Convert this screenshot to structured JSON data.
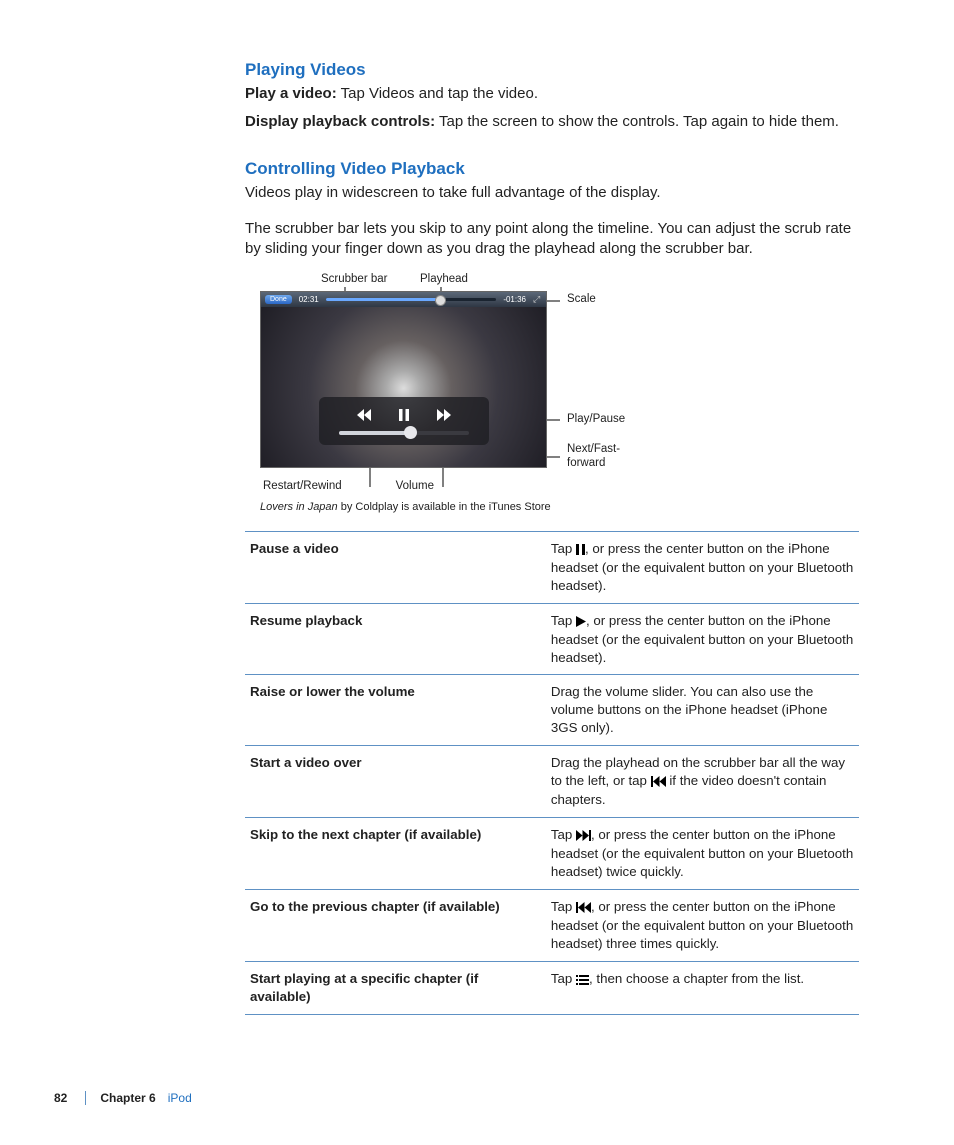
{
  "headings": {
    "h1": "Playing Videos",
    "h2": "Controlling Video Playback"
  },
  "p1a": "Play a video:",
  "p1b": "  Tap Videos and tap the video.",
  "p2a": "Display playback controls:",
  "p2b": "  Tap the screen to show the controls. Tap again to hide them.",
  "p3": "Videos play in widescreen to take full advantage of the display.",
  "p4": "The scrubber bar lets you skip to any point along the timeline. You can adjust the scrub rate by sliding your finger down as you drag the playhead along the scrubber bar.",
  "fig": {
    "scrubber": "Scrubber bar",
    "playhead": "Playhead",
    "scale": "Scale",
    "playpause": "Play/Pause",
    "next": "Next/Fast-forward",
    "restart": "Restart/Rewind",
    "volume": "Volume",
    "done": "Done",
    "t1": "02:31",
    "t2": "-01:36"
  },
  "credit_i": "Lovers in Japan",
  "credit_r": " by Coldplay is available in the iTunes Store",
  "rows": [
    {
      "l": "Pause a video",
      "a": "Tap ",
      "b": ", or press the center button on the iPhone headset (or the equivalent button on your Bluetooth headset).",
      "icon": "pause"
    },
    {
      "l": "Resume playback",
      "a": "Tap ",
      "b": ", or press the center button on the iPhone headset (or the equivalent button on your Bluetooth headset).",
      "icon": "play"
    },
    {
      "l": "Raise or lower the volume",
      "a": "Drag the volume slider. You can also use the volume buttons on the iPhone headset (iPhone 3GS only).",
      "icon": ""
    },
    {
      "l": "Start a video over",
      "a": "Drag the playhead on the scrubber bar all the way to the left, or tap ",
      "b": " if the video doesn't contain chapters.",
      "icon": "prev"
    },
    {
      "l": "Skip to the next chapter (if available)",
      "a": "Tap ",
      "b": ", or press the center button on the iPhone headset (or the equivalent button on your Bluetooth headset) twice quickly.",
      "icon": "next"
    },
    {
      "l": "Go to the previous chapter (if available)",
      "a": "Tap ",
      "b": ", or press the center button on the iPhone headset (or the equivalent button on your Bluetooth headset) three times quickly.",
      "icon": "prev"
    },
    {
      "l": "Start playing at a specific chapter (if available)",
      "a": "Tap ",
      "b": ", then choose a chapter from the list.",
      "icon": "list"
    }
  ],
  "footer": {
    "page": "82",
    "chapter": "Chapter 6",
    "name": "iPod"
  }
}
